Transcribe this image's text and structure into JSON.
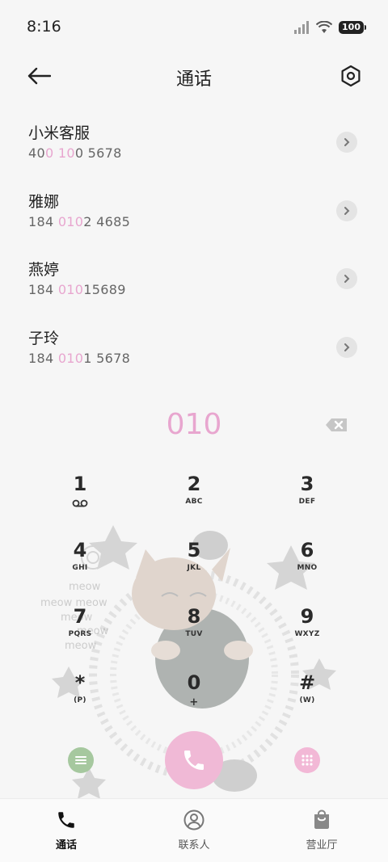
{
  "status_bar": {
    "time": "8:16",
    "battery": "100"
  },
  "header": {
    "title": "通话"
  },
  "contacts": [
    {
      "name": "小米客服",
      "number_parts": [
        "40",
        "0",
        " ",
        "10",
        "0 5678"
      ]
    },
    {
      "name": "雅娜",
      "number_parts": [
        "184 ",
        "010",
        "2 4685"
      ]
    },
    {
      "name": "燕婷",
      "number_parts": [
        "184 ",
        "010",
        "15689"
      ]
    },
    {
      "name": "子玲",
      "number_parts": [
        "184 ",
        "010",
        "1 5678"
      ]
    }
  ],
  "dialer": {
    "input": "010"
  },
  "keypad": [
    {
      "digit": "1",
      "letters": ""
    },
    {
      "digit": "2",
      "letters": "ABC"
    },
    {
      "digit": "3",
      "letters": "DEF"
    },
    {
      "digit": "4",
      "letters": "GHI"
    },
    {
      "digit": "5",
      "letters": "JKL"
    },
    {
      "digit": "6",
      "letters": "MNO"
    },
    {
      "digit": "7",
      "letters": "PQRS"
    },
    {
      "digit": "8",
      "letters": "TUV"
    },
    {
      "digit": "9",
      "letters": "WXYZ"
    },
    {
      "digit": "*",
      "letters": "(P)"
    },
    {
      "digit": "0",
      "letters": "+"
    },
    {
      "digit": "#",
      "letters": "(W)"
    }
  ],
  "illustration": {
    "text_lines": [
      "meow",
      "meow meow",
      "meow",
      "meow",
      "meow"
    ]
  },
  "bottom_nav": [
    {
      "label": "通话",
      "icon": "phone-icon",
      "active": true
    },
    {
      "label": "联系人",
      "icon": "person-icon",
      "active": false
    },
    {
      "label": "营业厅",
      "icon": "bag-icon",
      "active": false
    }
  ],
  "colors": {
    "accent_pink": "#e8a6cf",
    "call_button": "#f0b9d6",
    "menu_button": "#a6c89f"
  }
}
